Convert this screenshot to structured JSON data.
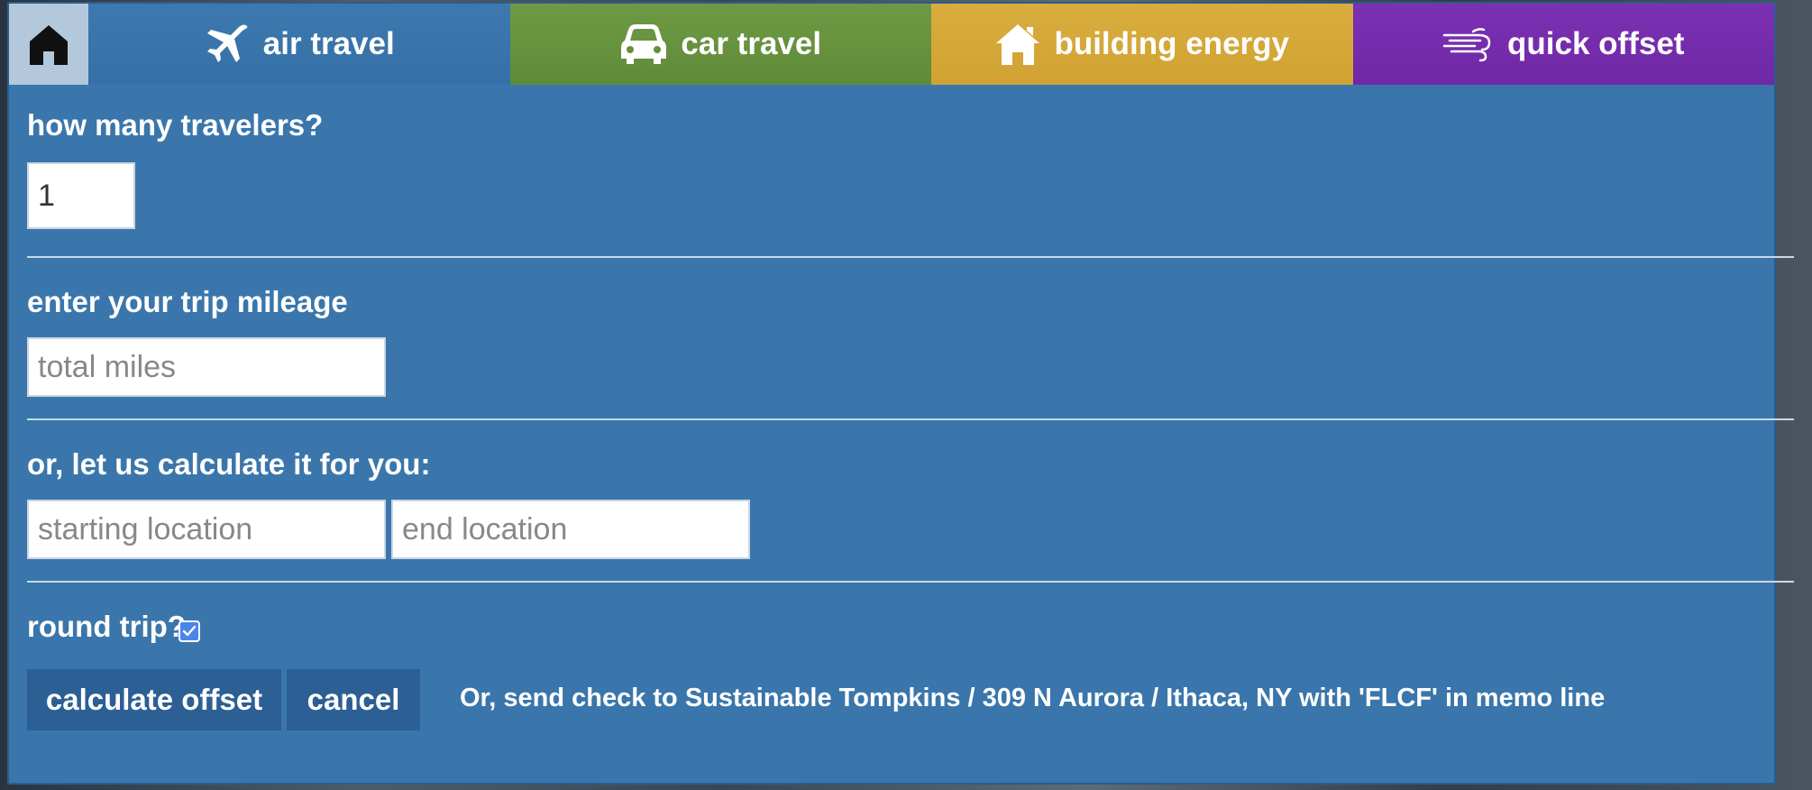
{
  "tabs": {
    "home_icon": "house-icon",
    "items": [
      {
        "label": "air travel",
        "icon": "airplane-icon"
      },
      {
        "label": "car travel",
        "icon": "car-icon"
      },
      {
        "label": "building energy",
        "icon": "house-icon"
      },
      {
        "label": "quick offset",
        "icon": "wind-icon"
      }
    ]
  },
  "form": {
    "travelers_label": "how many travelers?",
    "travelers_value": "1",
    "mileage_label": "enter your trip mileage",
    "mileage_placeholder": "total miles",
    "calc_label": "or, let us calculate it for you:",
    "start_placeholder": "starting location",
    "end_placeholder": "end location",
    "round_trip_label": "round trip?",
    "round_trip_checked": true
  },
  "actions": {
    "calculate_label": "calculate offset",
    "cancel_label": "cancel",
    "check_note": "Or, send check to Sustainable Tompkins / 309 N Aurora / Ithaca, NY with 'FLCF' in memo line"
  },
  "colors": {
    "panel": "#3a76ab",
    "air_tab": "#3570a6",
    "car_tab": "#658f3d",
    "building_tab": "#d4a737",
    "offset_tab": "#742cab",
    "home_tab": "#b3c8db",
    "button": "#2c5f94"
  }
}
